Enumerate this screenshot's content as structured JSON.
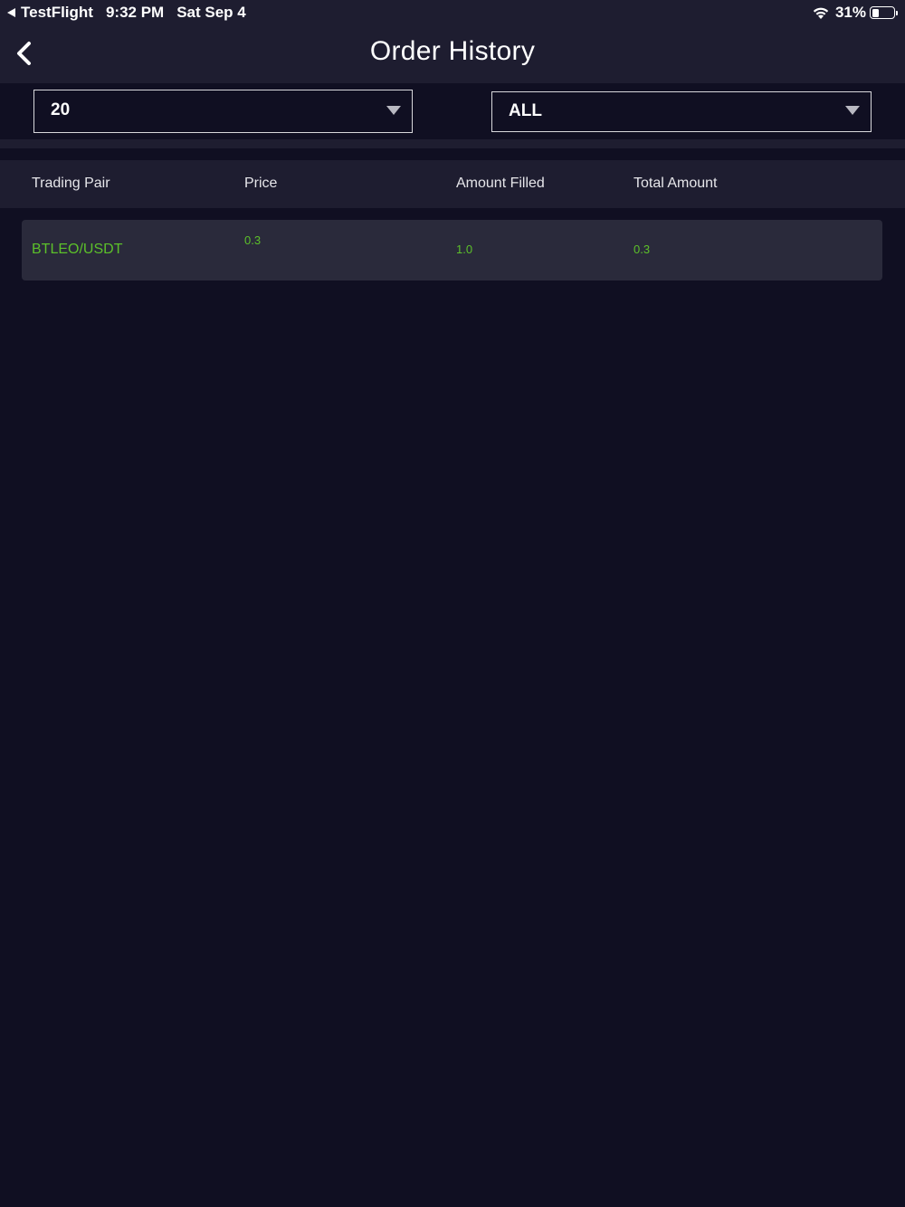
{
  "status_bar": {
    "app_name": "TestFlight",
    "time": "9:32 PM",
    "date": "Sat Sep 4",
    "battery_percent": "31%",
    "battery_level": 0.31
  },
  "header": {
    "title": "Order History",
    "back_icon": "chevron-left-icon"
  },
  "filters": {
    "count_select": {
      "value": "20"
    },
    "type_select": {
      "value": "ALL"
    }
  },
  "table": {
    "columns": [
      "Trading Pair",
      "Price",
      "Amount Filled",
      "Total Amount"
    ],
    "rows": [
      {
        "pair": "BTLEO/USDT",
        "price": "0.3",
        "amount_filled": "1.0",
        "total_amount": "0.3"
      }
    ]
  },
  "colors": {
    "background": "#100f22",
    "surface": "#1e1d30",
    "row": "#2a2a3b",
    "accent_green": "#5cc02a"
  }
}
